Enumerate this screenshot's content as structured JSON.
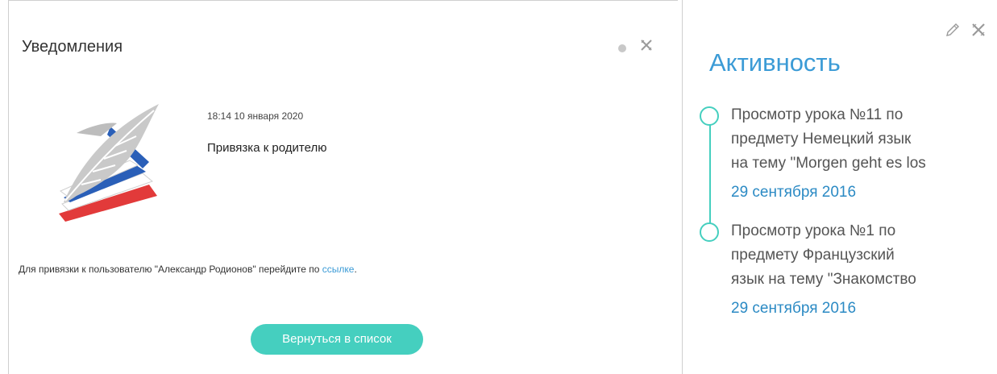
{
  "notifications": {
    "title": "Уведомления",
    "item": {
      "date": "18:14 10 января 2020",
      "subject": "Привязка к родителю",
      "body_prefix": "Для привязки к пользователю \"Александр Родионов\" перейдите по ",
      "link_text": "ссылке",
      "body_suffix": "."
    },
    "back_button": "Вернуться в список",
    "icons": {
      "status": "dot-icon",
      "close": "close-icon",
      "logo": "feather-book-logo"
    },
    "colors": {
      "accent": "#45cfbf",
      "link": "#3b9bd6"
    }
  },
  "activity": {
    "title": "Активность",
    "icons": {
      "edit": "pencil-icon",
      "close": "close-icon"
    },
    "items": [
      {
        "text": "Просмотр урока №11 по\nпредмету Немецкий язык\nна тему \"Morgen geht es los",
        "date": "29 сентября 2016"
      },
      {
        "text": "Просмотр урока №1 по\nпредмету Французский\nязык на тему \"Знакомство",
        "date": "29 сентября 2016"
      }
    ],
    "colors": {
      "title": "#3b9bd6",
      "timeline": "#45cfbf",
      "date": "#2b8ac4"
    }
  }
}
